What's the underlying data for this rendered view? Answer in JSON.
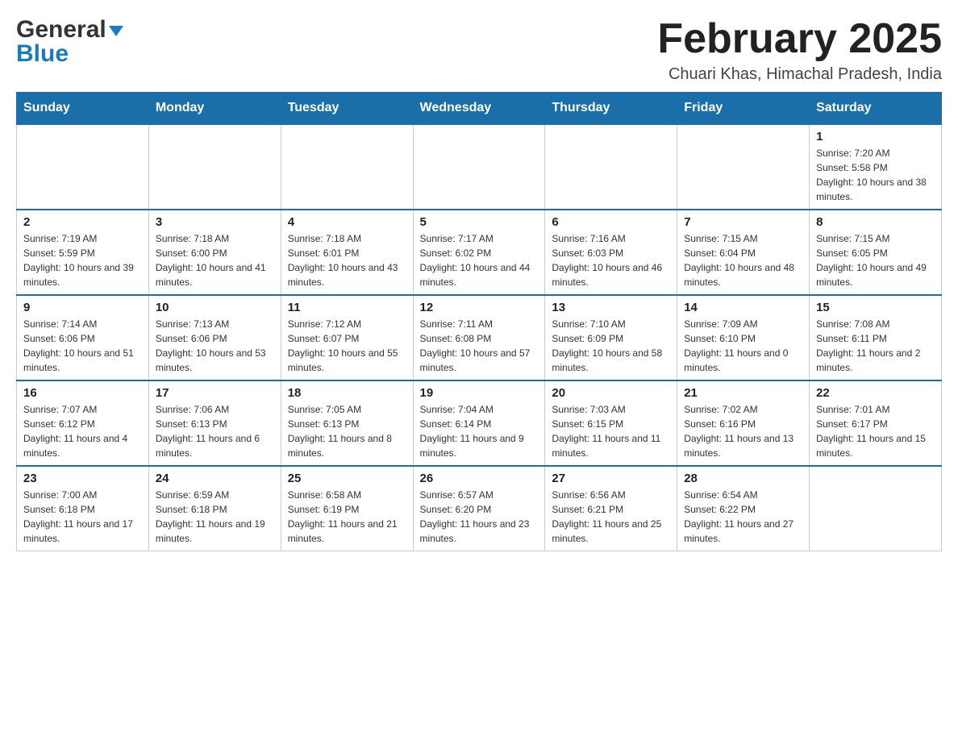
{
  "header": {
    "logo_general": "General",
    "logo_blue": "Blue",
    "month_title": "February 2025",
    "location": "Chuari Khas, Himachal Pradesh, India"
  },
  "weekdays": [
    "Sunday",
    "Monday",
    "Tuesday",
    "Wednesday",
    "Thursday",
    "Friday",
    "Saturday"
  ],
  "weeks": [
    [
      {
        "day": "",
        "info": ""
      },
      {
        "day": "",
        "info": ""
      },
      {
        "day": "",
        "info": ""
      },
      {
        "day": "",
        "info": ""
      },
      {
        "day": "",
        "info": ""
      },
      {
        "day": "",
        "info": ""
      },
      {
        "day": "1",
        "info": "Sunrise: 7:20 AM\nSunset: 5:58 PM\nDaylight: 10 hours and 38 minutes."
      }
    ],
    [
      {
        "day": "2",
        "info": "Sunrise: 7:19 AM\nSunset: 5:59 PM\nDaylight: 10 hours and 39 minutes."
      },
      {
        "day": "3",
        "info": "Sunrise: 7:18 AM\nSunset: 6:00 PM\nDaylight: 10 hours and 41 minutes."
      },
      {
        "day": "4",
        "info": "Sunrise: 7:18 AM\nSunset: 6:01 PM\nDaylight: 10 hours and 43 minutes."
      },
      {
        "day": "5",
        "info": "Sunrise: 7:17 AM\nSunset: 6:02 PM\nDaylight: 10 hours and 44 minutes."
      },
      {
        "day": "6",
        "info": "Sunrise: 7:16 AM\nSunset: 6:03 PM\nDaylight: 10 hours and 46 minutes."
      },
      {
        "day": "7",
        "info": "Sunrise: 7:15 AM\nSunset: 6:04 PM\nDaylight: 10 hours and 48 minutes."
      },
      {
        "day": "8",
        "info": "Sunrise: 7:15 AM\nSunset: 6:05 PM\nDaylight: 10 hours and 49 minutes."
      }
    ],
    [
      {
        "day": "9",
        "info": "Sunrise: 7:14 AM\nSunset: 6:06 PM\nDaylight: 10 hours and 51 minutes."
      },
      {
        "day": "10",
        "info": "Sunrise: 7:13 AM\nSunset: 6:06 PM\nDaylight: 10 hours and 53 minutes."
      },
      {
        "day": "11",
        "info": "Sunrise: 7:12 AM\nSunset: 6:07 PM\nDaylight: 10 hours and 55 minutes."
      },
      {
        "day": "12",
        "info": "Sunrise: 7:11 AM\nSunset: 6:08 PM\nDaylight: 10 hours and 57 minutes."
      },
      {
        "day": "13",
        "info": "Sunrise: 7:10 AM\nSunset: 6:09 PM\nDaylight: 10 hours and 58 minutes."
      },
      {
        "day": "14",
        "info": "Sunrise: 7:09 AM\nSunset: 6:10 PM\nDaylight: 11 hours and 0 minutes."
      },
      {
        "day": "15",
        "info": "Sunrise: 7:08 AM\nSunset: 6:11 PM\nDaylight: 11 hours and 2 minutes."
      }
    ],
    [
      {
        "day": "16",
        "info": "Sunrise: 7:07 AM\nSunset: 6:12 PM\nDaylight: 11 hours and 4 minutes."
      },
      {
        "day": "17",
        "info": "Sunrise: 7:06 AM\nSunset: 6:13 PM\nDaylight: 11 hours and 6 minutes."
      },
      {
        "day": "18",
        "info": "Sunrise: 7:05 AM\nSunset: 6:13 PM\nDaylight: 11 hours and 8 minutes."
      },
      {
        "day": "19",
        "info": "Sunrise: 7:04 AM\nSunset: 6:14 PM\nDaylight: 11 hours and 9 minutes."
      },
      {
        "day": "20",
        "info": "Sunrise: 7:03 AM\nSunset: 6:15 PM\nDaylight: 11 hours and 11 minutes."
      },
      {
        "day": "21",
        "info": "Sunrise: 7:02 AM\nSunset: 6:16 PM\nDaylight: 11 hours and 13 minutes."
      },
      {
        "day": "22",
        "info": "Sunrise: 7:01 AM\nSunset: 6:17 PM\nDaylight: 11 hours and 15 minutes."
      }
    ],
    [
      {
        "day": "23",
        "info": "Sunrise: 7:00 AM\nSunset: 6:18 PM\nDaylight: 11 hours and 17 minutes."
      },
      {
        "day": "24",
        "info": "Sunrise: 6:59 AM\nSunset: 6:18 PM\nDaylight: 11 hours and 19 minutes."
      },
      {
        "day": "25",
        "info": "Sunrise: 6:58 AM\nSunset: 6:19 PM\nDaylight: 11 hours and 21 minutes."
      },
      {
        "day": "26",
        "info": "Sunrise: 6:57 AM\nSunset: 6:20 PM\nDaylight: 11 hours and 23 minutes."
      },
      {
        "day": "27",
        "info": "Sunrise: 6:56 AM\nSunset: 6:21 PM\nDaylight: 11 hours and 25 minutes."
      },
      {
        "day": "28",
        "info": "Sunrise: 6:54 AM\nSunset: 6:22 PM\nDaylight: 11 hours and 27 minutes."
      },
      {
        "day": "",
        "info": ""
      }
    ]
  ]
}
